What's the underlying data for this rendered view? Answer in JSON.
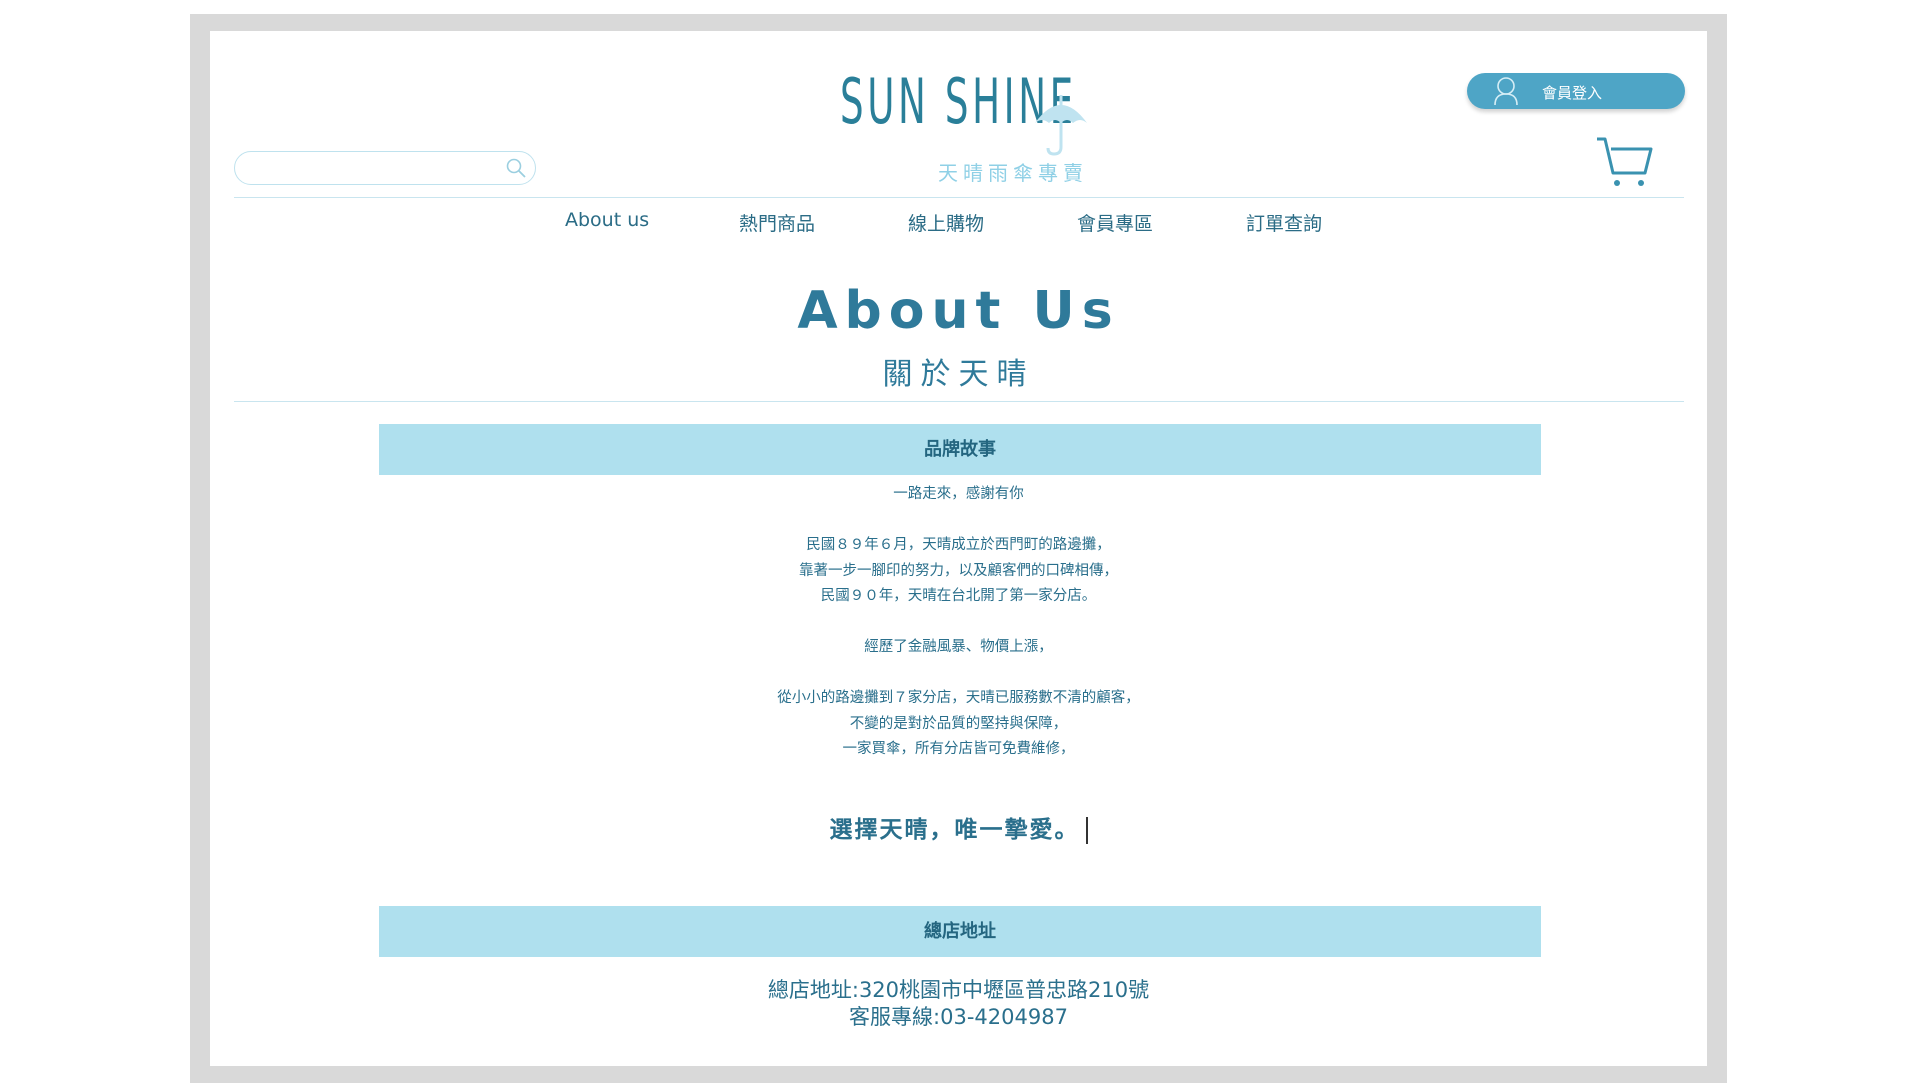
{
  "brand": {
    "name": "SUN SHINE",
    "subtitle": "天晴雨傘專賣"
  },
  "header": {
    "member_login": "會員登入",
    "search_placeholder": ""
  },
  "nav": {
    "items": [
      {
        "label": "About us"
      },
      {
        "label": "熱門商品"
      },
      {
        "label": "線上購物"
      },
      {
        "label": "會員專區"
      },
      {
        "label": "訂單查詢"
      }
    ]
  },
  "about": {
    "title": "About Us",
    "subtitle": "關於天晴"
  },
  "sections": {
    "story": {
      "header": "品牌故事",
      "lines": [
        "一路走來，感謝有你",
        "",
        "民國８９年６月，天晴成立於西門町的路邊攤，",
        "靠著一步一腳印的努力，以及顧客們的口碑相傳，",
        "民國９０年，天晴在台北開了第一家分店。",
        "",
        "經歷了金融風暴、物價上漲，",
        "",
        "從小小的路邊攤到７家分店，天晴已服務數不清的顧客，",
        "不變的是對於品質的堅持與保障，",
        "一家買傘，所有分店皆可免費維修，"
      ],
      "slogan": "選擇天晴，唯一摯愛。"
    },
    "address": {
      "header": "總店地址",
      "address_line": "總店地址:320桃園市中壢區普忠路210號",
      "phone_line": "客服專線:03-4204987"
    }
  },
  "colors": {
    "accent": "#2f7a9a",
    "section_bar": "#afe0ee",
    "button": "#4ea5c6",
    "frame": "#d9d9d9"
  }
}
